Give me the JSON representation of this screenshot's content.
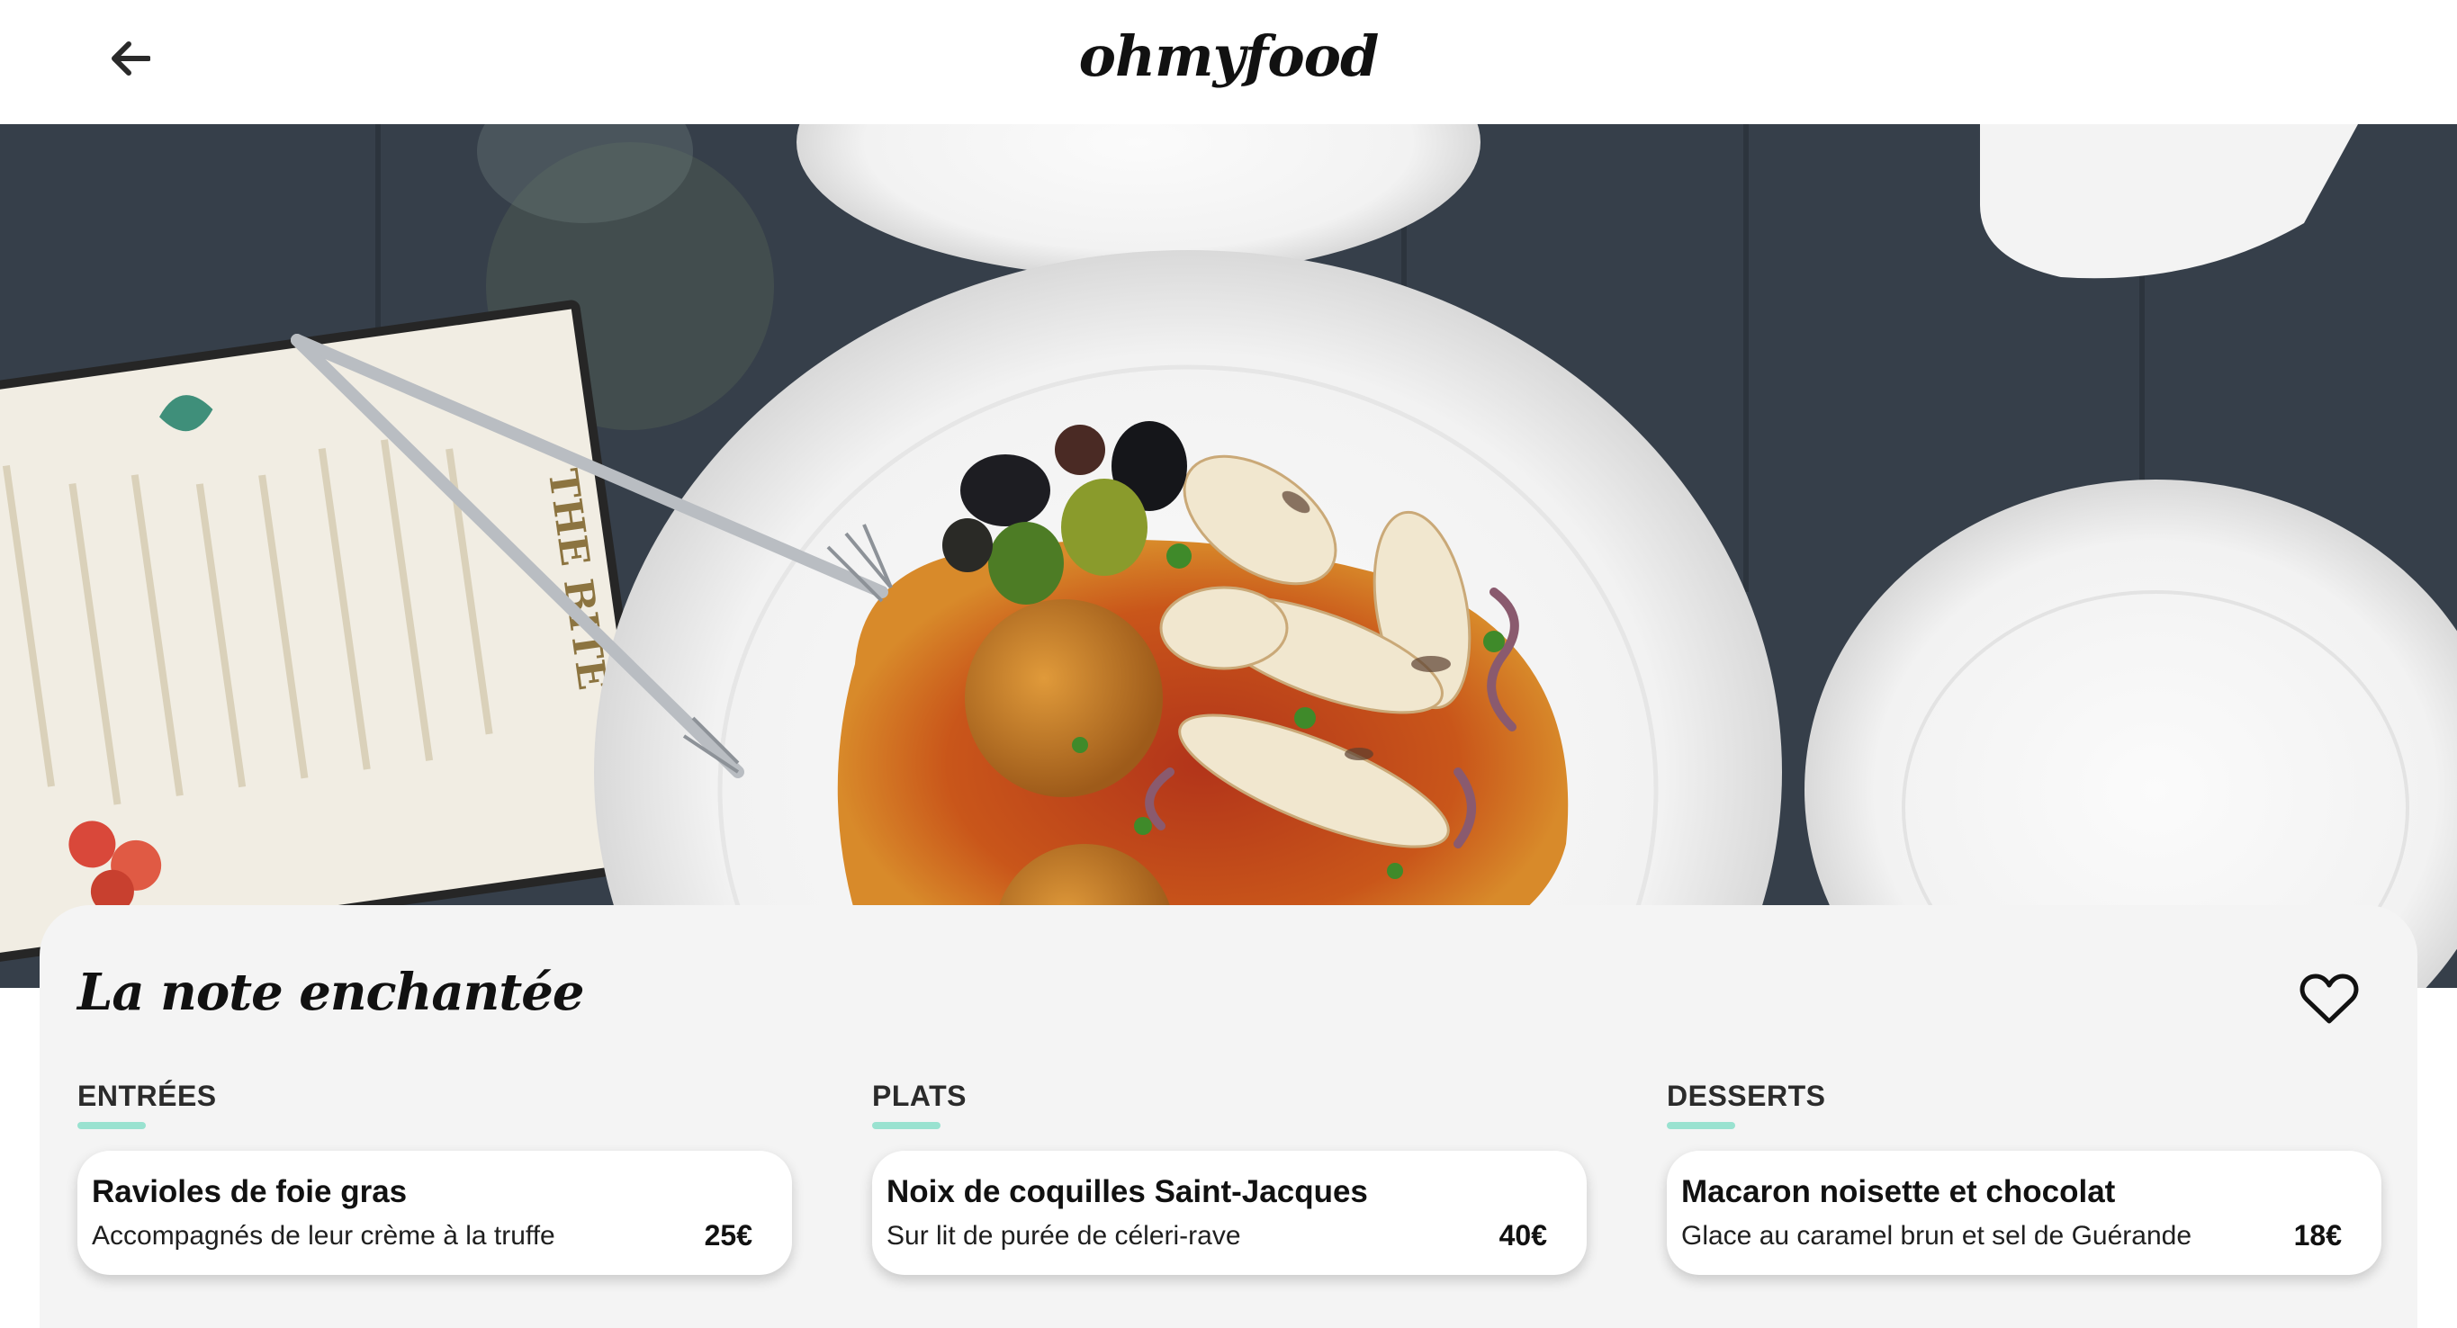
{
  "header": {
    "logo": "ohmyfood"
  },
  "hero": {
    "image_subject": "food-photo",
    "menu_prop_title": "THE BITE"
  },
  "restaurant": {
    "name": "La note enchantée"
  },
  "menu": {
    "sections": [
      {
        "title": "ENTRÉES",
        "dishes": [
          {
            "name": "Ravioles de foie gras",
            "description": "Accompagnés de leur crème à la truffe",
            "price": "25€"
          }
        ]
      },
      {
        "title": "PLATS",
        "dishes": [
          {
            "name": "Noix de coquilles Saint-Jacques",
            "description": "Sur lit de purée de céleri-rave",
            "price": "40€"
          }
        ]
      },
      {
        "title": "DESSERTS",
        "dishes": [
          {
            "name": "Macaron noisette et chocolat",
            "description": "Glace au caramel brun et sel de Guérande",
            "price": "18€"
          }
        ]
      }
    ]
  },
  "colors": {
    "accent": "#99e2d0",
    "card_background": "#f4f4f4"
  },
  "icons": {
    "back": "arrow-left-icon",
    "favorite": "heart-outline-icon"
  }
}
